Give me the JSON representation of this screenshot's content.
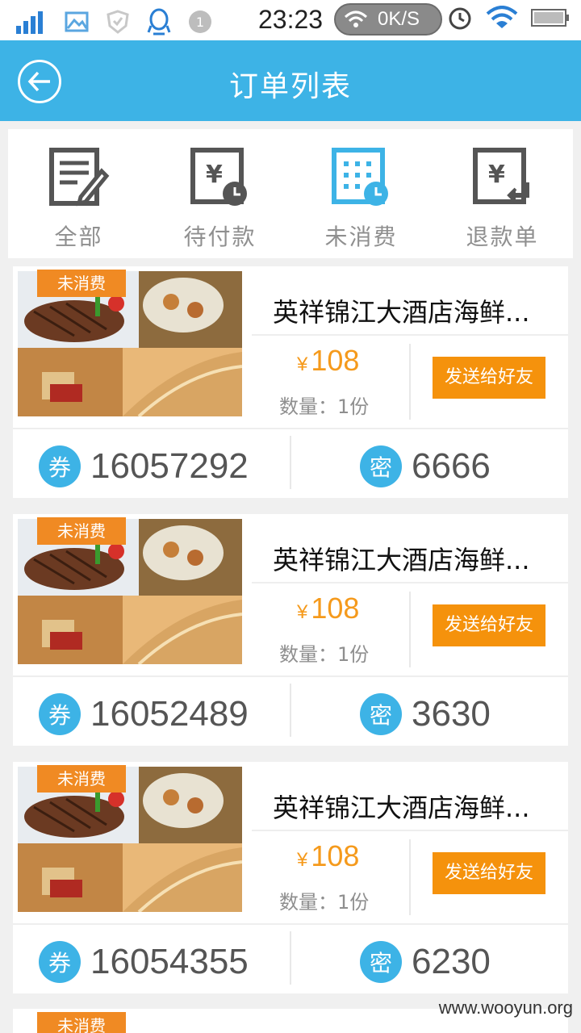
{
  "status_bar": {
    "time": "23:23",
    "net_speed": "0K/S",
    "notification_count": "1",
    "icons": [
      "signal-icon",
      "gallery-icon",
      "shield-icon",
      "qq-icon",
      "notification-icon",
      "wifi-icon",
      "alarm-icon",
      "battery-icon"
    ]
  },
  "header": {
    "title": "订单列表",
    "color": "#3db3e6"
  },
  "tabs": [
    {
      "label": "全部",
      "icon": "order-list-icon",
      "active": false
    },
    {
      "label": "待付款",
      "icon": "pending-payment-icon",
      "active": false
    },
    {
      "label": "未消费",
      "icon": "unconsumed-icon",
      "active": true
    },
    {
      "label": "退款单",
      "icon": "refund-icon",
      "active": false
    }
  ],
  "orders": [
    {
      "badge": "未消费",
      "title": "英祥锦江大酒店海鲜...",
      "currency": "¥",
      "price": "108",
      "qty": "数量：1份",
      "send_label": "发送给好友",
      "coupon_icon": "券",
      "coupon": "16057292",
      "pwd_icon": "密",
      "pwd": "6666"
    },
    {
      "badge": "未消费",
      "title": "英祥锦江大酒店海鲜...",
      "currency": "¥",
      "price": "108",
      "qty": "数量：1份",
      "send_label": "发送给好友",
      "coupon_icon": "券",
      "coupon": "16052489",
      "pwd_icon": "密",
      "pwd": "3630"
    },
    {
      "badge": "未消费",
      "title": "英祥锦江大酒店海鲜...",
      "currency": "¥",
      "price": "108",
      "qty": "数量：1份",
      "send_label": "发送给好友",
      "coupon_icon": "券",
      "coupon": "16054355",
      "pwd_icon": "密",
      "pwd": "6230"
    }
  ],
  "partial_order": {
    "badge": "未消费"
  },
  "watermark": "www.wooyun.org",
  "colors": {
    "accent": "#3db3e6",
    "orange": "#f5920c",
    "price": "#f59a1c"
  }
}
